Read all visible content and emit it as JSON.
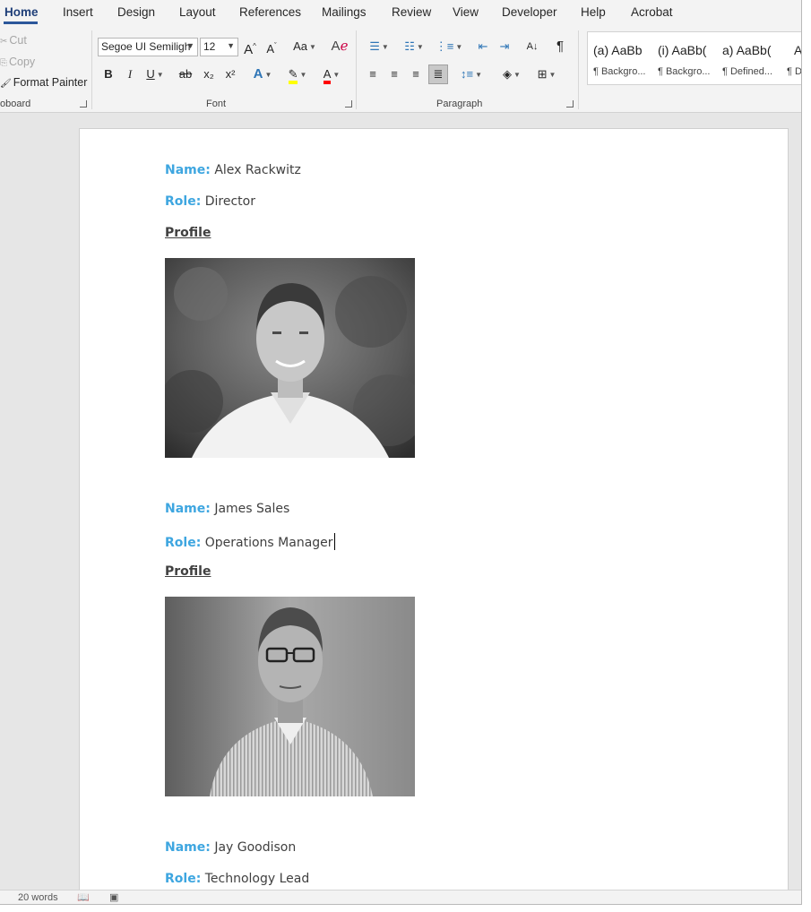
{
  "tabs": [
    {
      "label": "Home",
      "active": true
    },
    {
      "label": "Insert"
    },
    {
      "label": "Design"
    },
    {
      "label": "Layout"
    },
    {
      "label": "References"
    },
    {
      "label": "Mailings"
    },
    {
      "label": "Review"
    },
    {
      "label": "View"
    },
    {
      "label": "Developer"
    },
    {
      "label": "Help"
    },
    {
      "label": "Acrobat"
    }
  ],
  "clipboard": {
    "cut": "Cut",
    "copy": "Copy",
    "format_painter": "Format Painter",
    "group_label": "oboard"
  },
  "font": {
    "family": "Segoe UI Semiligh",
    "size": "12",
    "group_label": "Font",
    "grow_icon": "A^",
    "shrink_icon": "A˅",
    "case_icon": "Aa",
    "bold": "B",
    "italic": "I",
    "underline": "U",
    "strike": "ab",
    "subscript": "x₂",
    "superscript": "x²",
    "highlight_color": "#ffff00",
    "font_color": "#ff0000",
    "text_effects_color": "#2e75b6"
  },
  "paragraph": {
    "group_label": "Paragraph",
    "pilcrow": "¶"
  },
  "styles": [
    {
      "preview": "(a)  AaBb",
      "name": "¶ Backgro..."
    },
    {
      "preview": "(i)  AaBb(",
      "name": "¶ Backgro..."
    },
    {
      "preview": "a)  AaBb(",
      "name": "¶ Defined..."
    },
    {
      "preview": "A",
      "name": "¶ D"
    }
  ],
  "document": {
    "people": [
      {
        "name_label": "Name:",
        "name": "Alex Rackwitz",
        "role_label": "Role:",
        "role": "Director",
        "profile": "Profile",
        "photo_icon": "portrait-photo-alex"
      },
      {
        "name_label": "Name:",
        "name": "James Sales",
        "role_label": "Role:",
        "role": "Operations Manager",
        "profile": "Profile",
        "photo_icon": "portrait-photo-james"
      },
      {
        "name_label": "Name:",
        "name": "Jay Goodison",
        "role_label": "Role:",
        "role": "Technology Lead"
      }
    ]
  },
  "status": {
    "words": "20 words"
  }
}
